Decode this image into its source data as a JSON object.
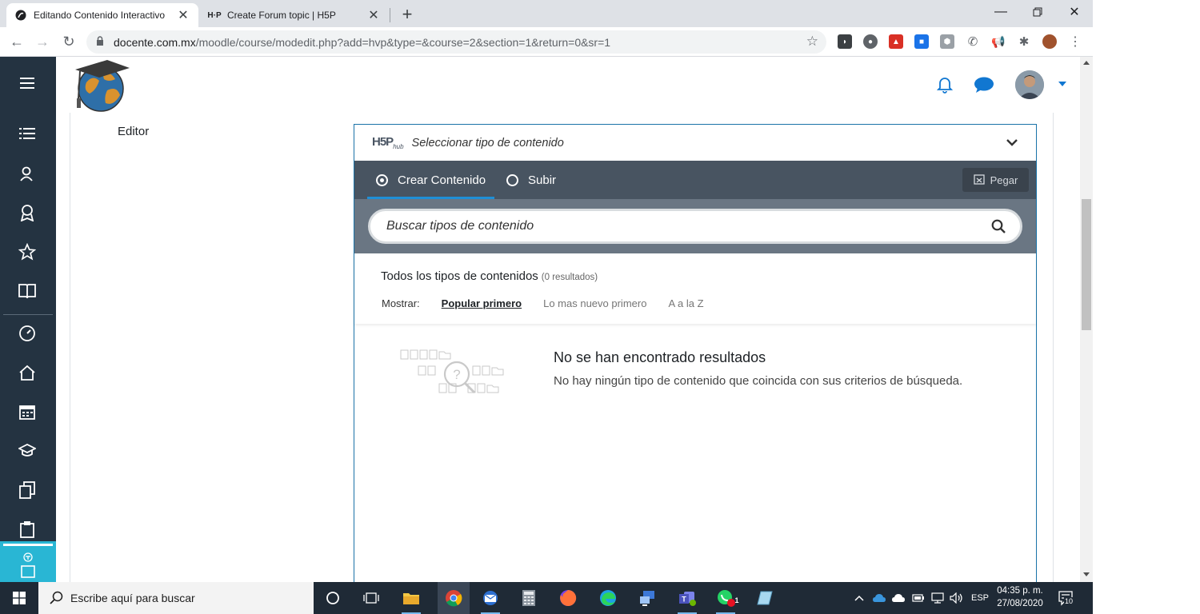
{
  "browser": {
    "tabs": [
      {
        "title": "Editando Contenido Interactivo",
        "active": true
      },
      {
        "title": "Create Forum topic | H5P",
        "active": false
      }
    ],
    "url_host": "docente.com.mx",
    "url_path": "/moodle/course/modedit.php?add=hvp&type=&course=2&section=1&return=0&sr=1"
  },
  "form": {
    "editor_label": "Editor"
  },
  "hub": {
    "logo_main": "H5P",
    "logo_sub": "hub",
    "title": "Seleccionar tipo de contenido",
    "tabs": [
      {
        "label": "Crear Contenido",
        "selected": true
      },
      {
        "label": "Subir",
        "selected": false
      }
    ],
    "paste_label": "Pegar",
    "search_placeholder": "Buscar tipos de contenido",
    "all_types_label": "Todos los tipos de contenidos",
    "results_count": "(0 resultados)",
    "show_label": "Mostrar:",
    "sort_options": [
      {
        "label": "Popular primero",
        "selected": true
      },
      {
        "label": "Lo mas nuevo primero",
        "selected": false
      },
      {
        "label": "A a la Z",
        "selected": false
      }
    ],
    "no_results_title": "No se han encontrado resultados",
    "no_results_text": "No hay ningún tipo de contenido que coincida con sus criterios de búsqueda."
  },
  "taskbar": {
    "search_placeholder": "Escribe aquí para buscar",
    "language": "ESP",
    "time": "04:35 p. m.",
    "date": "27/08/2020",
    "notification_count": "10",
    "whatsapp_badge": "1"
  },
  "colors": {
    "sidebar": "#243341",
    "hub_tabs": "#485461",
    "hub_search": "#6a7683",
    "accent": "#1177d1",
    "taskbar": "#1f2a36"
  }
}
